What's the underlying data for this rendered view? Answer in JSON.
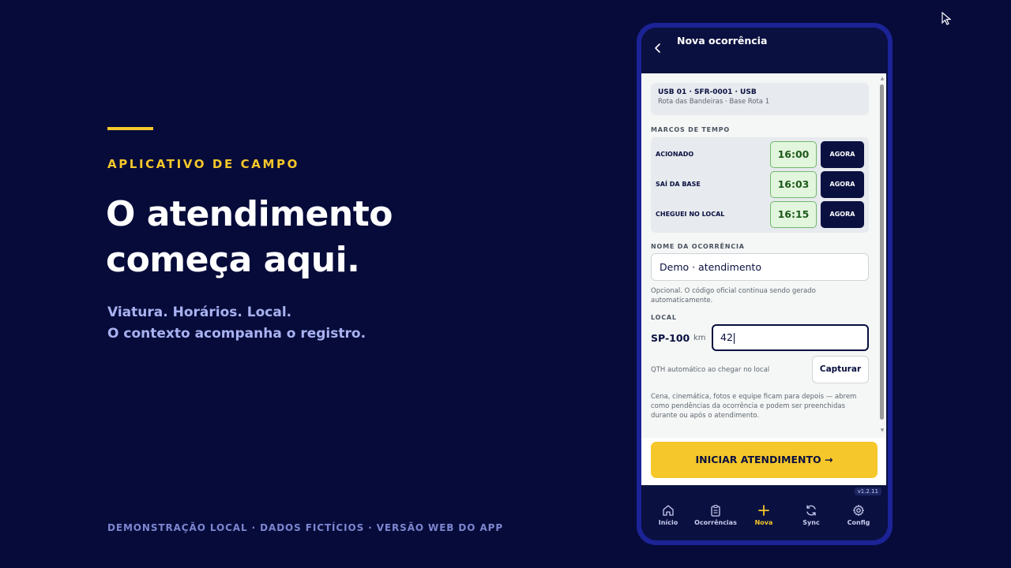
{
  "marketing": {
    "eyebrow": "APLICATIVO DE CAMPO",
    "headline_line1": "O atendimento",
    "headline_line2": "começa aqui.",
    "sub_line1": "Viatura. Horários. Local.",
    "sub_line2": "O contexto acompanha o registro.",
    "footer": "DEMONSTRAÇÃO LOCAL · DADOS FICTÍCIOS · VERSÃO WEB DO APP"
  },
  "app": {
    "header_title": "Nova ocorrência",
    "vehicle": {
      "id": "USB 01 · SFR-0001 · USB",
      "route": "Rota das Bandeiras · Base Rota 1"
    },
    "time_section_label": "MARCOS DE TEMPO",
    "time_marks": [
      {
        "label": "ACIONADO",
        "time": "16:00",
        "button": "AGORA"
      },
      {
        "label": "SAÍ DA BASE",
        "time": "16:03",
        "button": "AGORA"
      },
      {
        "label": "CHEGUEI NO LOCAL",
        "time": "16:15",
        "button": "AGORA"
      }
    ],
    "name_section_label": "NOME DA OCORRÊNCIA",
    "name_value": "Demo · atendimento",
    "name_hint": "Opcional. O código oficial continua sendo gerado automaticamente.",
    "location_section_label": "LOCAL",
    "road": "SP-100",
    "km_unit": "km",
    "km_value": "42",
    "qth_hint": "QTH automático ao chegar no local",
    "capture_button": "Capturar",
    "later_note": "Cena, cinemática, fotos e equipe ficam para depois — abrem como pendências da ocorrência e podem ser preenchidas durante ou após o atendimento.",
    "cta": "INICIAR ATENDIMENTO →",
    "version": "v1.2.11",
    "nav": [
      {
        "label": "Início",
        "icon": "home-icon"
      },
      {
        "label": "Ocorrências",
        "icon": "clipboard-icon"
      },
      {
        "label": "Nova",
        "icon": "plus-icon"
      },
      {
        "label": "Sync",
        "icon": "sync-icon"
      },
      {
        "label": "Config",
        "icon": "gear-icon"
      }
    ]
  },
  "colors": {
    "background": "#060b3a",
    "accent": "#f5c72a",
    "phone_frame": "#1c2396",
    "time_green": "#e2f5dd"
  }
}
